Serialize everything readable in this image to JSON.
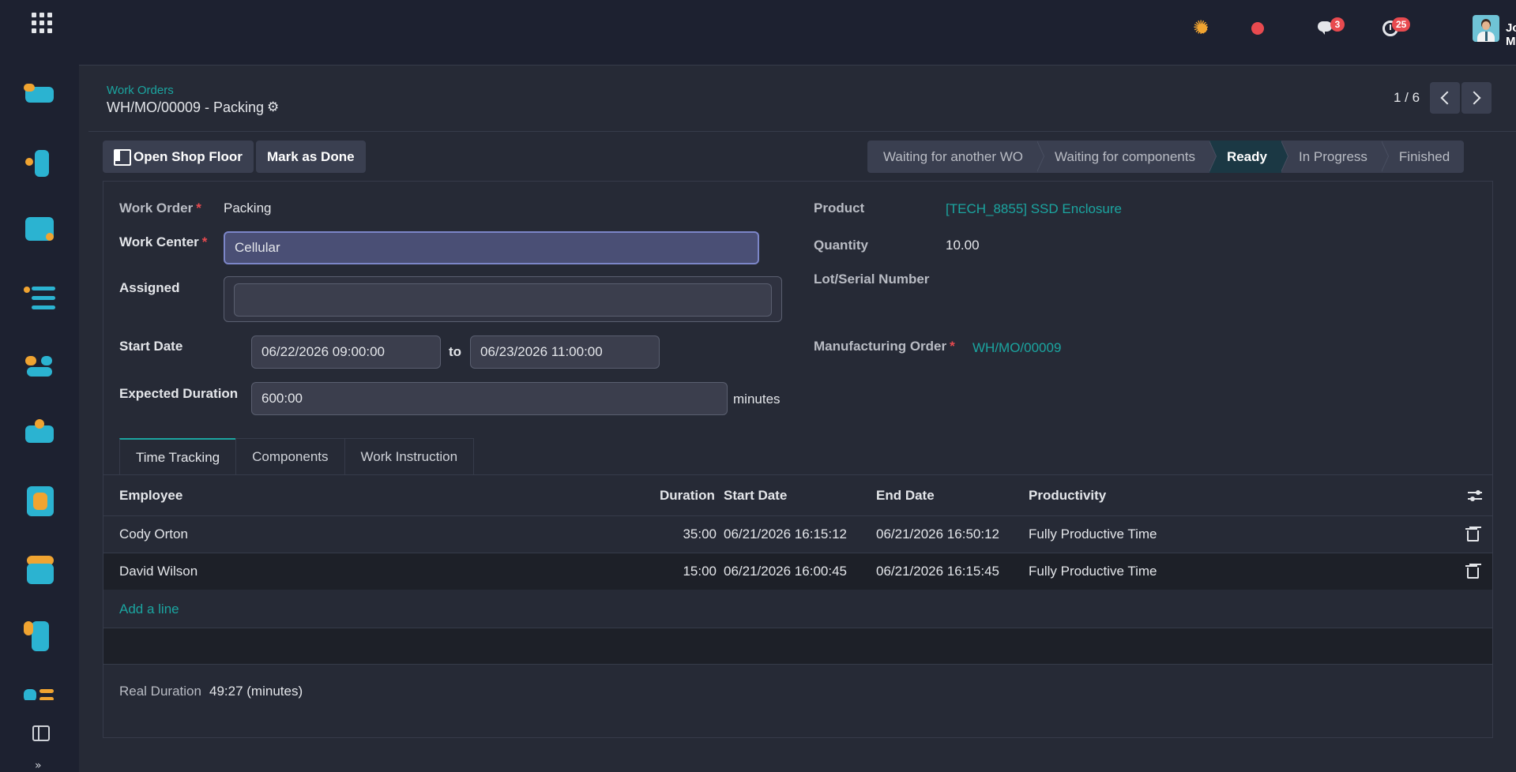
{
  "topbar": {
    "chat_badge": "3",
    "activity_badge": "25",
    "user_name": "Jordan Miles"
  },
  "sidebar": {
    "apps": [
      {
        "icon": "inventory-app-icon",
        "colors": [
          "#2bb3d1",
          "#f0a431"
        ]
      },
      {
        "icon": "manufacturing-app-icon",
        "colors": [
          "#2bb3d1",
          "#f0a431"
        ]
      },
      {
        "icon": "purchase-app-icon",
        "colors": [
          "#2bb3d1",
          "#f0a431"
        ]
      },
      {
        "icon": "project-app-icon",
        "colors": [
          "#2bb3d1",
          "#f0a431"
        ]
      },
      {
        "icon": "employees-app-icon",
        "colors": [
          "#2bb3d1",
          "#f0a431"
        ]
      },
      {
        "icon": "crm-app-icon",
        "colors": [
          "#2bb3d1",
          "#f0a431"
        ]
      },
      {
        "icon": "accounting-app-icon",
        "colors": [
          "#2bb3d1",
          "#f0a431"
        ]
      },
      {
        "icon": "point-of-sale-app-icon",
        "colors": [
          "#2bb3d1",
          "#f0a431"
        ]
      },
      {
        "icon": "quality-app-icon",
        "colors": [
          "#2bb3d1",
          "#f0a431"
        ]
      },
      {
        "icon": "planning-app-icon",
        "colors": [
          "#2bb3d1",
          "#f0a431"
        ]
      }
    ],
    "more_glyph": "»"
  },
  "control_panel": {
    "breadcrumb": "Work Orders",
    "record_title": "WH/MO/00009 - Packing",
    "pager": "1 / 6"
  },
  "actions": {
    "shop_floor": "Open Shop Floor",
    "mark_done": "Mark as Done"
  },
  "status_stages": [
    {
      "label": "Waiting for another WO",
      "active": false
    },
    {
      "label": "Waiting for components",
      "active": false
    },
    {
      "label": "Ready",
      "active": true
    },
    {
      "label": "In Progress",
      "active": false
    },
    {
      "label": "Finished",
      "active": false
    }
  ],
  "form": {
    "work_order_label": "Work Order",
    "work_order_value": "Packing",
    "work_center_label": "Work Center",
    "work_center_value": "Cellular",
    "assigned_label": "Assigned",
    "assigned_value": "",
    "start_date_label": "Start Date",
    "start_date_from": "06/22/2026 09:00:00",
    "to_label": "to",
    "start_date_to": "06/23/2026 11:00:00",
    "expected_duration_label": "Expected Duration",
    "expected_duration_value": "600:00",
    "expected_duration_unit": "minutes",
    "product_label": "Product",
    "product_value": "[TECH_8855] SSD Enclosure",
    "quantity_label": "Quantity",
    "quantity_value": "10.00",
    "lot_label": "Lot/Serial Number",
    "mo_label": "Manufacturing Order",
    "mo_value": "WH/MO/00009",
    "required_mark": "*"
  },
  "tabs": [
    {
      "label": "Time Tracking",
      "active": true
    },
    {
      "label": "Components",
      "active": false
    },
    {
      "label": "Work Instruction",
      "active": false
    }
  ],
  "time_table": {
    "headers": {
      "employee": "Employee",
      "duration": "Duration",
      "start": "Start Date",
      "end": "End Date",
      "productivity": "Productivity"
    },
    "rows": [
      {
        "employee": "Cody Orton",
        "duration": "35:00",
        "start": "06/21/2026 16:15:12",
        "end": "06/21/2026 16:50:12",
        "productivity": "Fully Productive Time"
      },
      {
        "employee": "David Wilson",
        "duration": "15:00",
        "start": "06/21/2026 16:00:45",
        "end": "06/21/2026 16:15:45",
        "productivity": "Fully Productive Time"
      }
    ],
    "add_line": "Add a line"
  },
  "real_duration": {
    "label": "Real Duration",
    "value": "49:27 (minutes)"
  }
}
